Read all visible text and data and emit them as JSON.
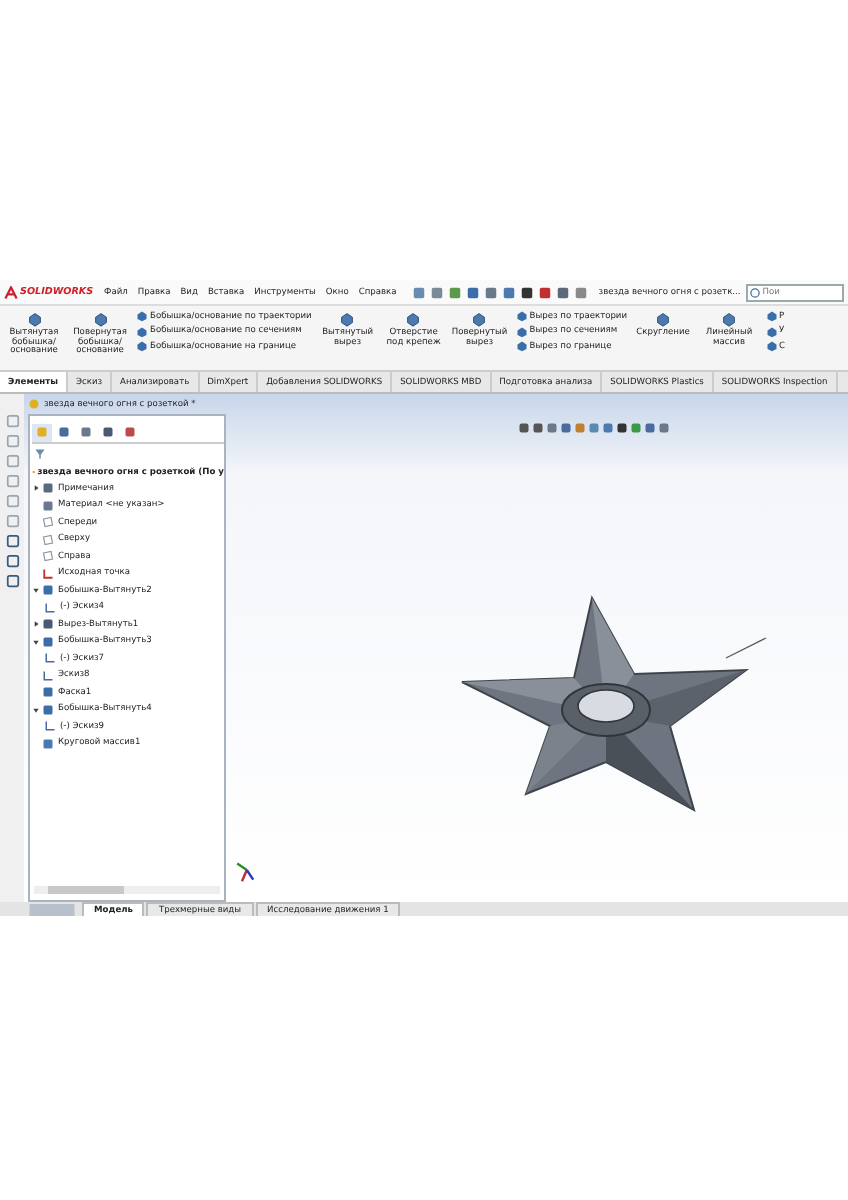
{
  "logo": "SOLIDWORKS",
  "menu": [
    "Файл",
    "Правка",
    "Вид",
    "Вставка",
    "Инструменты",
    "Окно",
    "Справка"
  ],
  "document_title": "звезда вечного огня с розетк...",
  "search": {
    "placeholder": "Пои"
  },
  "ribbon": [
    {
      "kind": "large",
      "label": "Вытянутая бобышка/основание"
    },
    {
      "kind": "large",
      "label": "Повернутая бобышка/основание"
    },
    {
      "kind": "stack",
      "items": [
        "Бобышка/основание по траектории",
        "Бобышка/основание по сечениям",
        "Бобышка/основание на границе"
      ]
    },
    {
      "kind": "large",
      "label": "Вытянутый вырез"
    },
    {
      "kind": "large",
      "label": "Отверстие под крепеж"
    },
    {
      "kind": "large",
      "label": "Повернутый вырез"
    },
    {
      "kind": "stack",
      "items": [
        "Вырез по траектории",
        "Вырез по сечениям",
        "Вырез по границе"
      ]
    },
    {
      "kind": "large",
      "label": "Скругление"
    },
    {
      "kind": "large",
      "label": "Линейный массив"
    },
    {
      "kind": "stack",
      "items": [
        "Р",
        "У",
        "С"
      ]
    }
  ],
  "tabs": [
    {
      "label": "Элементы",
      "selected": true
    },
    {
      "label": "Эскиз",
      "selected": false
    },
    {
      "label": "Анализировать",
      "selected": false
    },
    {
      "label": "DimXpert",
      "selected": false
    },
    {
      "label": "Добавления SOLIDWORKS",
      "selected": false
    },
    {
      "label": "SOLIDWORKS MBD",
      "selected": false
    },
    {
      "label": "Подготовка анализа",
      "selected": false
    },
    {
      "label": "SOLIDWORKS Plastics",
      "selected": false
    },
    {
      "label": "SOLIDWORKS Inspection",
      "selected": false
    }
  ],
  "breadcrumb": "звезда вечного огня с розеткой *",
  "tree": {
    "root": "звезда вечного огня с розеткой  (По у",
    "items": [
      {
        "kind": "notes",
        "label": "Примечания",
        "expanded": false
      },
      {
        "kind": "material",
        "label": "Материал <не указан>"
      },
      {
        "kind": "plane",
        "label": "Спереди"
      },
      {
        "kind": "plane",
        "label": "Сверху"
      },
      {
        "kind": "plane",
        "label": "Справа"
      },
      {
        "kind": "origin",
        "label": "Исходная точка"
      },
      {
        "kind": "extrude",
        "label": "Бобышка-Вытянуть2",
        "expanded": true,
        "children": [
          {
            "kind": "sketch",
            "label": "(-) Эскиз4"
          }
        ]
      },
      {
        "kind": "cut",
        "label": "Вырез-Вытянуть1",
        "expanded": false
      },
      {
        "kind": "extrude",
        "label": "Бобышка-Вытянуть3",
        "expanded": true,
        "children": [
          {
            "kind": "sketch",
            "label": "(-) Эскиз7"
          }
        ]
      },
      {
        "kind": "sketch",
        "label": "Эскиз8"
      },
      {
        "kind": "chamfer",
        "label": "Фаска1"
      },
      {
        "kind": "extrude",
        "label": "Бобышка-Вытянуть4",
        "expanded": true,
        "children": [
          {
            "kind": "sketch",
            "label": "(-) Эскиз9"
          }
        ]
      },
      {
        "kind": "pattern",
        "label": "Круговой массив1"
      }
    ]
  },
  "bottom_tabs": [
    {
      "label": "Модель",
      "selected": true
    },
    {
      "label": "Трехмерные виды",
      "selected": false
    },
    {
      "label": "Исследование движения 1",
      "selected": false
    }
  ]
}
